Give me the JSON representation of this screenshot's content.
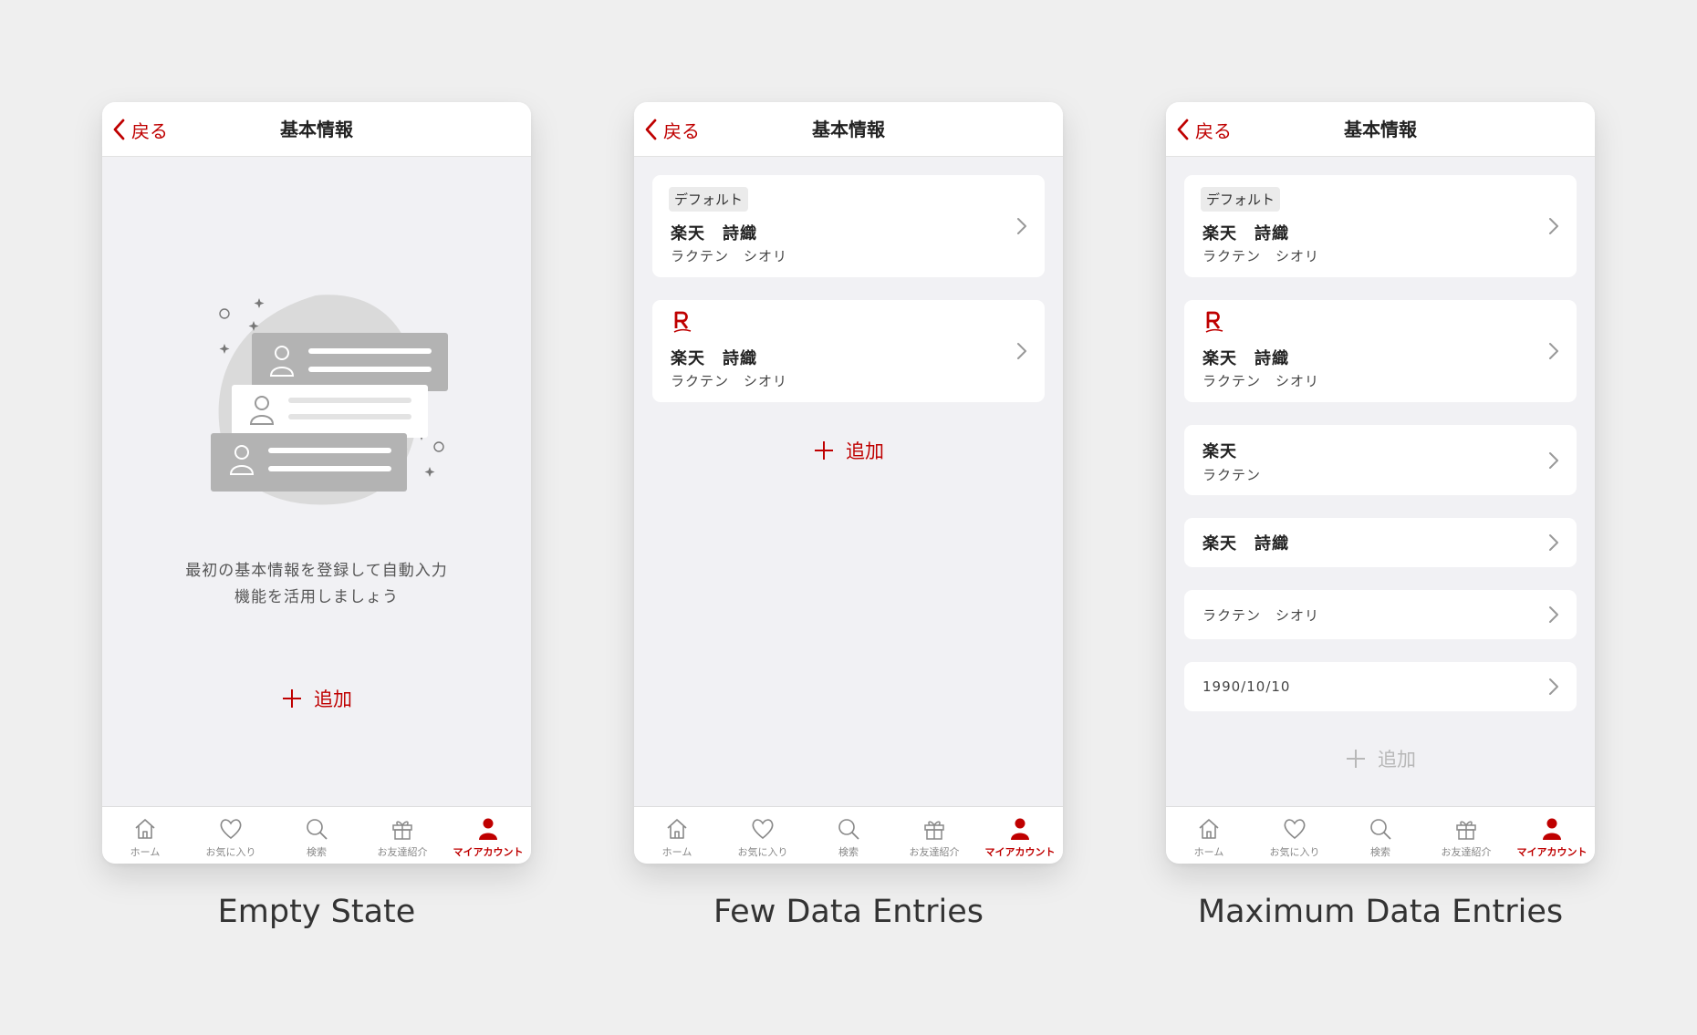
{
  "colors": {
    "accent": "#bf0000",
    "background": "#efefef",
    "screen_bg": "#f1f1f4"
  },
  "nav": {
    "back_label": "戻る",
    "title": "基本情報"
  },
  "tabs": [
    {
      "label": "ホーム",
      "icon": "home-icon"
    },
    {
      "label": "お気に入り",
      "icon": "heart-icon"
    },
    {
      "label": "検索",
      "icon": "search-icon"
    },
    {
      "label": "お友達紹介",
      "icon": "gift-icon"
    },
    {
      "label": "マイアカウント",
      "icon": "user-icon",
      "active": true
    }
  ],
  "screens": {
    "empty": {
      "caption": "Empty State",
      "message_line1": "最初の基本情報を登録して自動入力",
      "message_line2": "機能を活用しましょう",
      "add_label": "追加"
    },
    "few": {
      "caption": "Few Data Entries",
      "entries": [
        {
          "badge": "デフォルト",
          "name": "楽天　詩織",
          "kana": "ラクテン　シオリ"
        },
        {
          "logo": "rakuten-r-icon",
          "name": "楽天　詩織",
          "kana": "ラクテン　シオリ"
        }
      ],
      "add_label": "追加"
    },
    "max": {
      "caption": "Maximum Data Entries",
      "entries": [
        {
          "badge": "デフォルト",
          "name": "楽天　詩織",
          "kana": "ラクテン　シオリ"
        },
        {
          "logo": "rakuten-r-icon",
          "name": "楽天　詩織",
          "kana": "ラクテン　シオリ"
        },
        {
          "name": "楽天",
          "kana": "ラクテン"
        },
        {
          "name": "楽天　詩織"
        },
        {
          "kana": "ラクテン　シオリ"
        },
        {
          "kana": "1990/10/10"
        }
      ],
      "add_label": "追加",
      "add_disabled": true
    }
  }
}
